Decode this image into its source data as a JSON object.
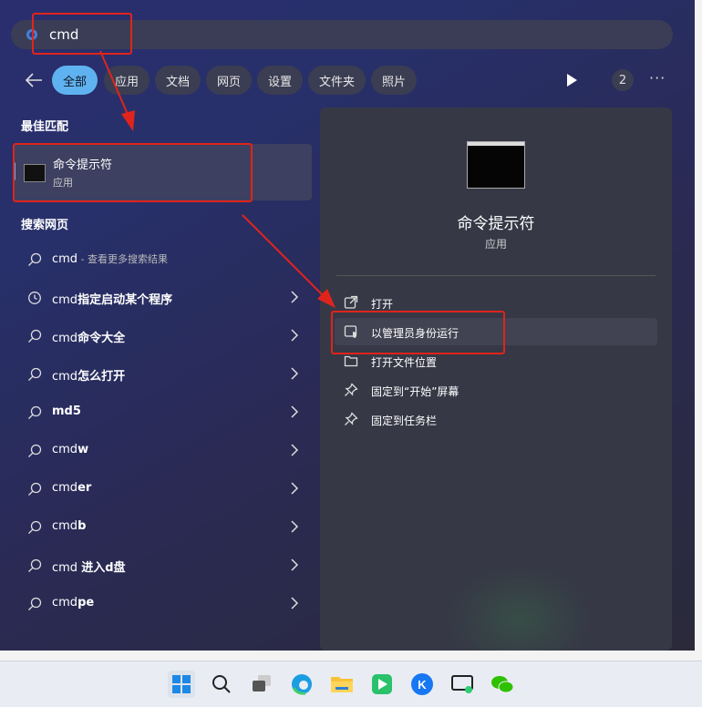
{
  "search": {
    "value": "cmd"
  },
  "filters": {
    "tabs": [
      {
        "label": "全部",
        "active": true
      },
      {
        "label": "应用"
      },
      {
        "label": "文档"
      },
      {
        "label": "网页"
      },
      {
        "label": "设置"
      },
      {
        "label": "文件夹"
      },
      {
        "label": "照片"
      }
    ],
    "count": "2",
    "more": "···"
  },
  "best_match": {
    "title": "最佳匹配",
    "name": "命令提示符",
    "type": "应用"
  },
  "web_section": {
    "title": "搜索网页",
    "items": [
      {
        "prefix": "cmd",
        "bold": "",
        "suffix": " - 查看更多搜索结果",
        "icon": "search-icon"
      },
      {
        "prefix": "cmd",
        "bold": "指定启动某个程序",
        "suffix": "",
        "icon": "history-icon"
      },
      {
        "prefix": "cmd",
        "bold": "命令大全",
        "suffix": "",
        "icon": "search-icon"
      },
      {
        "prefix": "cmd",
        "bold": "怎么打开",
        "suffix": "",
        "icon": "search-icon"
      },
      {
        "prefix": "",
        "bold": "md5",
        "suffix": "",
        "icon": "search-icon"
      },
      {
        "prefix": "cmd",
        "bold": "w",
        "suffix": "",
        "icon": "search-icon"
      },
      {
        "prefix": "cmd",
        "bold": "er",
        "suffix": "",
        "icon": "search-icon"
      },
      {
        "prefix": "cmd",
        "bold": "b",
        "suffix": "",
        "icon": "search-icon"
      },
      {
        "prefix": "cmd ",
        "bold": "进入d盘",
        "suffix": "",
        "icon": "search-icon"
      },
      {
        "prefix": "cmd",
        "bold": "pe",
        "suffix": "",
        "icon": "search-icon"
      }
    ]
  },
  "detail": {
    "name": "命令提示符",
    "type": "应用",
    "actions": [
      {
        "label": "打开",
        "icon": "open-external-icon"
      },
      {
        "label": "以管理员身份运行",
        "icon": "admin-shield-icon"
      },
      {
        "label": "打开文件位置",
        "icon": "folder-icon"
      },
      {
        "label": "固定到“开始”屏幕",
        "icon": "pin-icon"
      },
      {
        "label": "固定到任务栏",
        "icon": "pin-icon"
      }
    ]
  },
  "colors": {
    "accent": "#5fb2f0",
    "highlight_red": "#e0241b"
  }
}
